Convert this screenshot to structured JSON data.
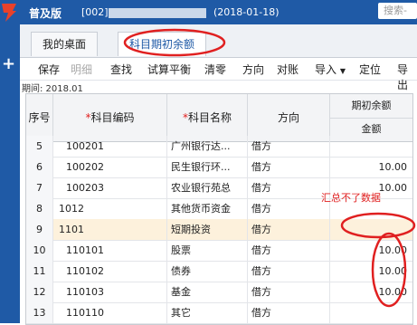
{
  "titlebar": {
    "edition": "普及版",
    "account_prefix": "[002]",
    "period": "(2018-01-18)",
    "search_placeholder": "搜索-",
    "bg_color": "#1f5aa6"
  },
  "tabs": [
    {
      "label": "我的桌面"
    },
    {
      "label": "科目期初余额"
    }
  ],
  "toolbar": {
    "items": [
      "保存",
      "明细",
      "查找",
      "试算平衡",
      "清零",
      "方向",
      "对账",
      "导入",
      "定位",
      "导出"
    ],
    "disabled": [
      "明细"
    ]
  },
  "period_line": "期间: 2018.01",
  "table": {
    "headers": {
      "no": "序号",
      "code_star": "*",
      "code": "科目编码",
      "name_star": "*",
      "name": "科目名称",
      "dir": "方向",
      "balance_group": "期初余额",
      "amount": "金额"
    },
    "rows": [
      {
        "no": "5",
        "code": "100201",
        "name": "广州银行达...",
        "dir": "借方",
        "amount": ""
      },
      {
        "no": "6",
        "code": "100202",
        "name": "民生银行环...",
        "dir": "借方",
        "amount": "10.00"
      },
      {
        "no": "7",
        "code": "100203",
        "name": "农业银行苑总",
        "dir": "借方",
        "amount": "10.00"
      },
      {
        "no": "8",
        "code": "1012",
        "name": "其他货币资金",
        "dir": "借方",
        "amount": ""
      },
      {
        "no": "9",
        "code": "1101",
        "name": "短期投资",
        "dir": "借方",
        "amount": ""
      },
      {
        "no": "10",
        "code": "110101",
        "name": "股票",
        "dir": "借方",
        "amount": "10.00"
      },
      {
        "no": "11",
        "code": "110102",
        "name": "债券",
        "dir": "借方",
        "amount": "10.00"
      },
      {
        "no": "12",
        "code": "110103",
        "name": "基金",
        "dir": "借方",
        "amount": "10.00"
      },
      {
        "no": "13",
        "code": "110110",
        "name": "其它",
        "dir": "借方",
        "amount": ""
      }
    ]
  },
  "annotation": "汇总不了数据",
  "colors": {
    "annotation_red": "#e02020",
    "highlight_row": "#fdf1dc"
  }
}
